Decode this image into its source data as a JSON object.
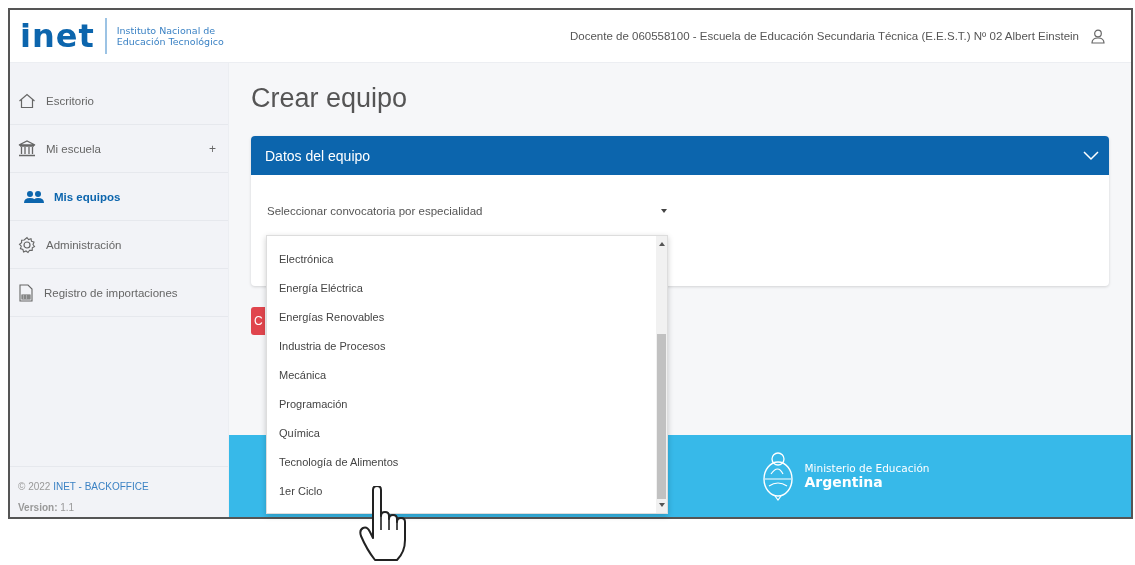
{
  "header": {
    "logo": "inet",
    "logo_subtitle": "Instituto Nacional de Educación Tecnológico",
    "user": "Docente de 060558100 - Escuela de Educación Secundaria Técnica (E.E.S.T.) Nº 02 Albert Einstein"
  },
  "sidebar": {
    "items": [
      {
        "label": "Escritorio",
        "kind": "home",
        "selected": false
      },
      {
        "label": "Mi escuela",
        "kind": "school",
        "selected": false,
        "expand": "+"
      },
      {
        "label": "Mis equipos",
        "kind": "team",
        "selected": true
      },
      {
        "label": "Administración",
        "kind": "admin",
        "selected": false
      },
      {
        "label": "Registro de importaciones",
        "kind": "log",
        "selected": false
      }
    ],
    "copyright": "© 2022",
    "copyright_link": "INET - BACKOFFICE",
    "version_label": "Version:",
    "version": "1.1"
  },
  "page_title": "Crear equipo",
  "card": {
    "title": "Datos del equipo",
    "expanded": true,
    "select_label": "Seleccionar convocatoria por especialidad",
    "button": "C"
  },
  "dropdown": {
    "options": [
      {
        "label": "Electrónica"
      },
      {
        "label": "Energía Eléctrica"
      },
      {
        "label": "Energías Renovables"
      },
      {
        "label": "Industria de Procesos"
      },
      {
        "label": "Mecánica"
      },
      {
        "label": "Programación"
      },
      {
        "label": "Química"
      },
      {
        "label": "Tecnología de Alimentos"
      },
      {
        "label": "1er Ciclo"
      }
    ]
  },
  "footer": {
    "ministry": "Ministerio de Educación",
    "country": "Argentina"
  }
}
